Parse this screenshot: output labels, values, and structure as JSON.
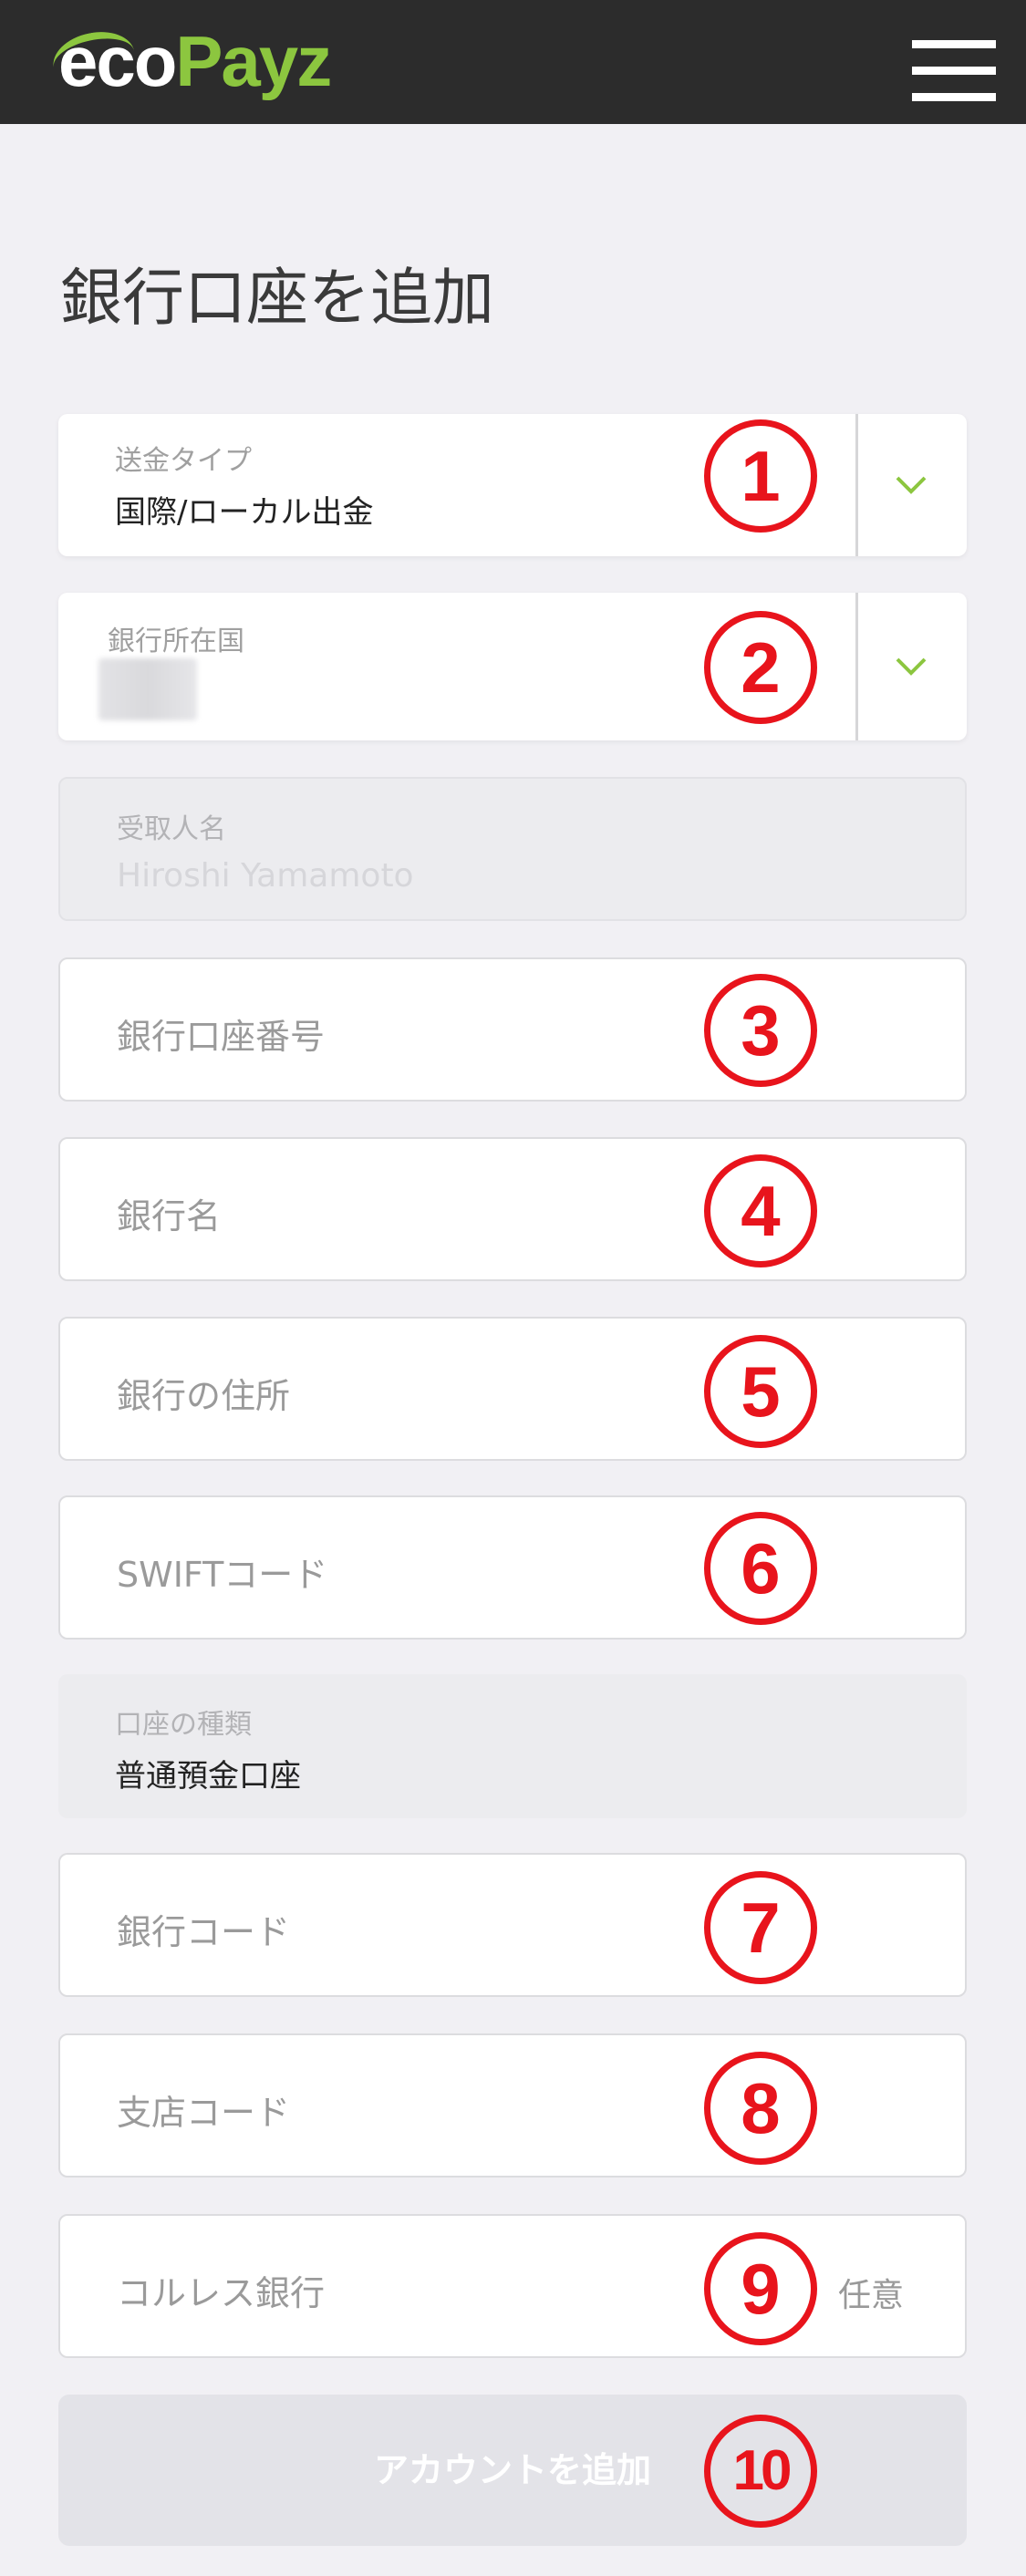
{
  "header": {
    "logo_eco": "eco",
    "logo_payz": "Payz",
    "menu_icon": "hamburger-menu-icon"
  },
  "page": {
    "title": "銀行口座を追加"
  },
  "form": {
    "transfer_type": {
      "label": "送金タイプ",
      "value": "国際/ローカル出金"
    },
    "bank_country": {
      "label": "銀行所在国",
      "value": ""
    },
    "recipient_name": {
      "label": "受取人名",
      "value": "Hiroshi Yamamoto"
    },
    "account_number": {
      "placeholder": "銀行口座番号"
    },
    "bank_name": {
      "placeholder": "銀行名"
    },
    "bank_address": {
      "placeholder": "銀行の住所"
    },
    "swift_code": {
      "placeholder": "SWIFTコード"
    },
    "account_type": {
      "label": "口座の種類",
      "value": "普通預金口座"
    },
    "bank_code": {
      "placeholder": "銀行コード"
    },
    "branch_code": {
      "placeholder": "支店コード"
    },
    "correspondent_bank": {
      "placeholder": "コルレス銀行",
      "optional": "任意"
    },
    "submit_label": "アカウントを追加"
  },
  "annotations": [
    "1",
    "2",
    "3",
    "4",
    "5",
    "6",
    "7",
    "8",
    "9",
    "10"
  ],
  "colors": {
    "header_bg": "#2c2c2c",
    "brand_green": "#8cc63f",
    "annotation_red": "#e8141c",
    "page_bg": "#f1f0f4"
  }
}
